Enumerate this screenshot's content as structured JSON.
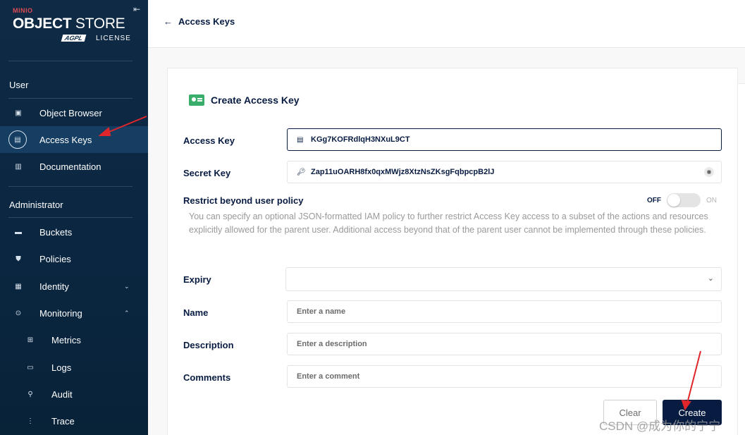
{
  "sidebar": {
    "logo": {
      "minio": "MINIO",
      "brand_bold": "OBJECT",
      "brand_rest": " STORE",
      "agpl": "AGPL",
      "license": "LICENSE"
    },
    "sections": {
      "user": "User",
      "admin": "Administrator"
    },
    "items": [
      {
        "label": "Object Browser",
        "icon": "object-browser-icon"
      },
      {
        "label": "Access Keys",
        "icon": "access-keys-icon",
        "active": true
      },
      {
        "label": "Documentation",
        "icon": "documentation-icon"
      },
      {
        "label": "Buckets",
        "icon": "buckets-icon"
      },
      {
        "label": "Policies",
        "icon": "policies-icon"
      },
      {
        "label": "Identity",
        "icon": "identity-icon",
        "expandable": true
      },
      {
        "label": "Monitoring",
        "icon": "monitoring-icon",
        "expanded": true
      },
      {
        "label": "Metrics",
        "icon": "metrics-icon"
      },
      {
        "label": "Logs",
        "icon": "logs-icon"
      },
      {
        "label": "Audit",
        "icon": "audit-icon"
      },
      {
        "label": "Trace",
        "icon": "trace-icon"
      }
    ]
  },
  "header": {
    "back_label": "Access Keys"
  },
  "form": {
    "title": "Create Access Key",
    "access_key": {
      "label": "Access Key",
      "value": "KGg7KOFRdlqH3NXuL9CT"
    },
    "secret_key": {
      "label": "Secret Key",
      "value": "Zap11uOARH8fx0qxMWjz8XtzNsZKsgFqbpcpB2lJ"
    },
    "restrict": {
      "label": "Restrict beyond user policy",
      "off": "OFF",
      "on": "ON",
      "enabled": false,
      "help": "You can specify an optional JSON-formatted IAM policy to further restrict Access Key access to a subset of the actions and resources explicitly allowed for the parent user. Additional access beyond that of the parent user cannot be implemented through these policies."
    },
    "expiry": {
      "label": "Expiry",
      "value": ""
    },
    "name": {
      "label": "Name",
      "placeholder": "Enter a name"
    },
    "description": {
      "label": "Description",
      "placeholder": "Enter a description"
    },
    "comments": {
      "label": "Comments",
      "placeholder": "Enter a comment"
    },
    "buttons": {
      "clear": "Clear",
      "create": "Create"
    }
  },
  "colors": {
    "sidebar_bg": "#0e2a44",
    "primary": "#081c42",
    "annotation": "#e0262b"
  },
  "watermark": "CSDN @成为你的宁宁"
}
